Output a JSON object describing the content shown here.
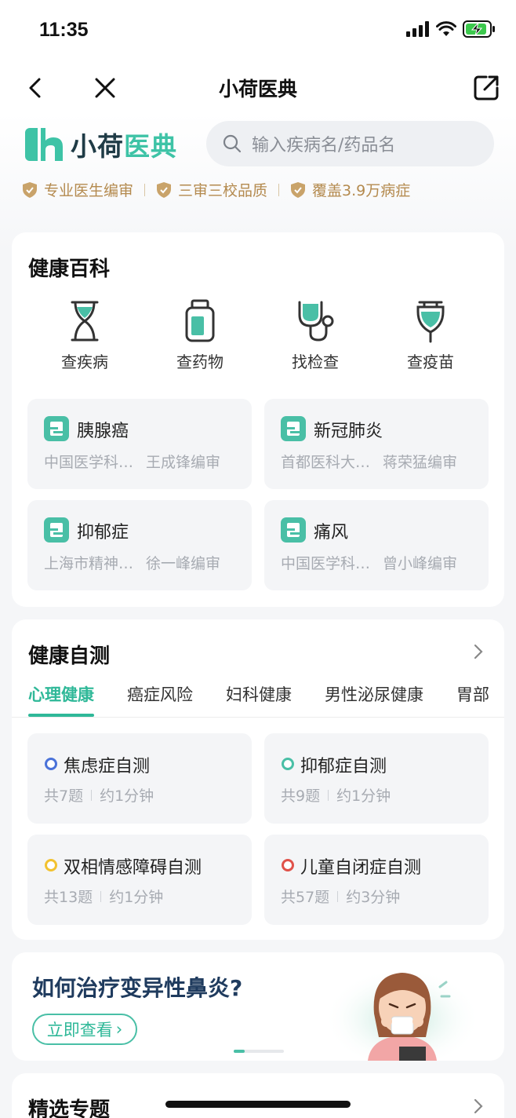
{
  "status": {
    "time": "11:35"
  },
  "nav": {
    "title": "小荷医典"
  },
  "brand": {
    "name_a": "小荷",
    "name_b": "医典"
  },
  "search": {
    "placeholder": "输入疾病名/药品名"
  },
  "badges": [
    "专业医生编审",
    "三审三校品质",
    "覆盖3.9万病症"
  ],
  "encyclopedia": {
    "title": "健康百科",
    "categories": [
      {
        "label": "查疾病",
        "icon": "dna-icon"
      },
      {
        "label": "查药物",
        "icon": "medicine-bottle-icon"
      },
      {
        "label": "找检查",
        "icon": "stethoscope-icon"
      },
      {
        "label": "查疫苗",
        "icon": "vaccine-icon"
      }
    ],
    "diseases": [
      {
        "name": "胰腺癌",
        "org": "中国医学科…",
        "reviewer": "王成锋编审"
      },
      {
        "name": "新冠肺炎",
        "org": "首都医科大…",
        "reviewer": "蒋荣猛编审"
      },
      {
        "name": "抑郁症",
        "org": "上海市精神…",
        "reviewer": "徐一峰编审"
      },
      {
        "name": "痛风",
        "org": "中国医学科…",
        "reviewer": "曾小峰编审"
      }
    ]
  },
  "self_test": {
    "title": "健康自测",
    "tabs": [
      "心理健康",
      "癌症风险",
      "妇科健康",
      "男性泌尿健康",
      "胃部"
    ],
    "active_tab": "心理健康",
    "tests": [
      {
        "name": "焦虑症自测",
        "count": "共7题",
        "duration": "约1分钟",
        "color": "#4a72d9"
      },
      {
        "name": "抑郁症自测",
        "count": "共9题",
        "duration": "约1分钟",
        "color": "#49bfa6"
      },
      {
        "name": "双相情感障碍自测",
        "count": "共13题",
        "duration": "约1分钟",
        "color": "#f2c230"
      },
      {
        "name": "儿童自闭症自测",
        "count": "共57题",
        "duration": "约3分钟",
        "color": "#e0524a"
      }
    ]
  },
  "banner": {
    "title": "如何治疗变异性鼻炎?",
    "button": "立即查看"
  },
  "featured": {
    "title": "精选专题"
  },
  "colors": {
    "accent": "#2fb898",
    "badge_gold": "#b48a4e",
    "brand_dark": "#1f3b46"
  }
}
